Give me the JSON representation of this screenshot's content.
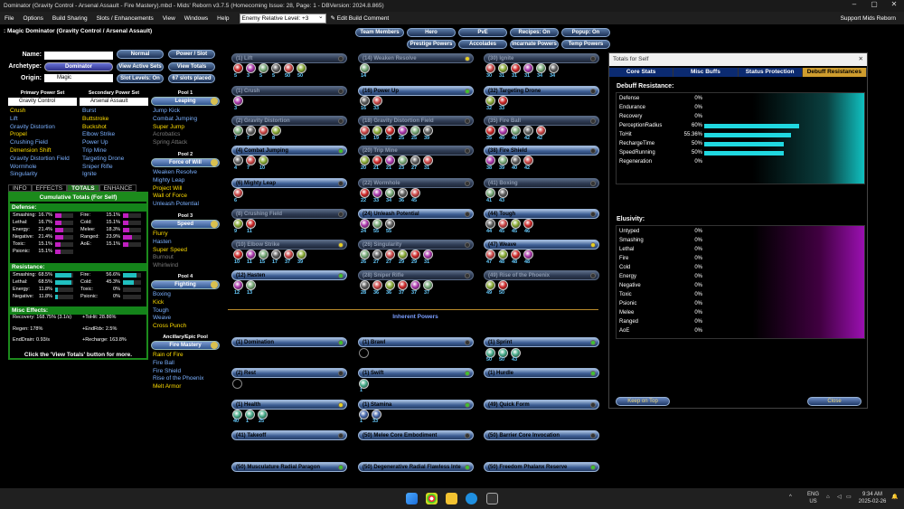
{
  "window": {
    "title": "Dominator (Gravity Control - Arsenal Assault - Fire Mastery).mbd - Mids' Reborn v3.7.5  (Homecoming Issue: 28, Page: 1 - DBVersion: 2024.8.865)"
  },
  "menu": {
    "items": [
      "File",
      "Options",
      "Build Sharing",
      "Slots / Enhancements",
      "View",
      "Windows",
      "Help"
    ],
    "level": "Enemy Relative Level: +3",
    "edit_comment": "Edit Build Comment",
    "support": "Support Mids Reborn"
  },
  "build": {
    "heading": ": Magic Dominator (Gravity Control / Arsenal Assault)"
  },
  "top_buttons": [
    "Team Members",
    "Hero",
    "PvE",
    "Recipes: On",
    "Popup: On",
    "Prestige Powers",
    "Accolades",
    "Incarnate Powers",
    "Temp Powers"
  ],
  "char": {
    "name_label": "Name:",
    "name_value": "",
    "archetype_label": "Archetype:",
    "archetype_value": "Dominator",
    "origin_label": "Origin:",
    "origin_value": "Magic"
  },
  "side_buttons": {
    "normal": "Normal",
    "power_slot": "Power / Slot",
    "view_active_sets": "View Active Sets",
    "view_totals": "View Totals",
    "slot_levels": "Slot Levels: On",
    "slots_placed": "67 slots placed"
  },
  "primary": {
    "header": "Primary Power Set",
    "selected": "Gravity Control",
    "powers": [
      "Crush",
      "Lift",
      "Gravity Distortion",
      "Propel",
      "Crushing Field",
      "Dimension Shift",
      "Gravity Distortion Field",
      "Wormhole",
      "Singularity"
    ]
  },
  "secondary": {
    "header": "Secondary Power Set",
    "selected": "Arsenal Assault",
    "powers": [
      "Burst",
      "Buttstroke",
      "Buckshot",
      "Elbow Strike",
      "Power Up",
      "Trip Mine",
      "Targeting Drone",
      "Sniper Rifle",
      "Ignite"
    ]
  },
  "pools": [
    {
      "header": "Pool 1",
      "name": "Leaping",
      "powers": [
        "Jump Kick",
        "Combat Jumping",
        "Super Jump",
        "Acrobatics",
        "Spring Attack"
      ]
    },
    {
      "header": "Pool 2",
      "name": "Force of Will",
      "powers": [
        "Weaken Resolve",
        "Mighty Leap",
        "Project Will",
        "Wall of Force",
        "Unleash Potential"
      ]
    },
    {
      "header": "Pool 3",
      "name": "Speed",
      "powers": [
        "Flurry",
        "Hasten",
        "Super Speed",
        "Burnout",
        "Whirlwind"
      ]
    },
    {
      "header": "Pool 4",
      "name": "Fighting",
      "powers": [
        "Boxing",
        "Kick",
        "Tough",
        "Weave",
        "Cross Punch"
      ]
    },
    {
      "header": "Ancillary/Epic Pool",
      "name": "Fire Mastery",
      "powers": [
        "Rain of Fire",
        "Fire Ball",
        "Fire Shield",
        "Rise of the Phoenix",
        "Melt Armor"
      ]
    }
  ],
  "info_tabs": [
    "INFO",
    "EFFECTS",
    "TOTALS",
    "ENHANCE"
  ],
  "totals": {
    "title": "Cumulative Totals (For Self)",
    "defense_label": "Defense:",
    "defense": [
      [
        "Smashing:",
        "16.7%",
        0.33
      ],
      [
        "Lethal:",
        "16.7%",
        0.33
      ],
      [
        "Energy:",
        "21.4%",
        0.43
      ],
      [
        "Negative:",
        "21.4%",
        0.43
      ],
      [
        "Toxic:",
        "15.1%",
        0.3
      ],
      [
        "Psionic:",
        "15.1%",
        0.3
      ]
    ],
    "defense2": [
      [
        "Fire:",
        "15.1%",
        0.3
      ],
      [
        "Cold:",
        "15.1%",
        0.3
      ],
      [
        "Melee:",
        "18.3%",
        0.37
      ],
      [
        "Ranged:",
        "23.9%",
        0.48
      ],
      [
        "AoE:",
        "15.1%",
        0.3
      ]
    ],
    "resistance_label": "Resistance:",
    "resistance": [
      [
        "Smashing:",
        "68.5%",
        0.9
      ],
      [
        "Lethal:",
        "68.5%",
        0.9
      ],
      [
        "Energy:",
        "11.8%",
        0.15
      ],
      [
        "Negative:",
        "11.8%",
        0.15
      ]
    ],
    "resistance2": [
      [
        "Fire:",
        "56.6%",
        0.75
      ],
      [
        "Cold:",
        "45.3%",
        0.6
      ],
      [
        "Toxic:",
        "0%",
        0.0
      ],
      [
        "Psionic:",
        "0%",
        0.0
      ]
    ],
    "misc_label": "Misc Effects:",
    "misc": [
      "Recovery: 168.75% (3.1/s)",
      "+ToHit: 28.86%",
      "Regen: 178%",
      "+EndRdx: 2.5%",
      "EndDrain: 0.93/s",
      "+Recharge: 163.8%"
    ],
    "footnote": "Click the 'View Totals' button for more."
  },
  "slots": [
    {
      "label": "(1) Lift",
      "enh": [
        "5",
        "3",
        "5",
        "5",
        "50",
        "50"
      ],
      "dot": "",
      "dim": true
    },
    {
      "label": "(1) Crush",
      "enh": [
        "3"
      ],
      "dot": "",
      "dim": true
    },
    {
      "label": "(2) Gravity Distortion",
      "enh": [
        "7",
        "7",
        "8",
        "8"
      ],
      "dot": "",
      "dim": true
    },
    {
      "label": "(4) Combat Jumping",
      "enh": [
        "4",
        "7",
        "10"
      ],
      "dot": "g",
      "dim": false
    },
    {
      "label": "(6) Mighty Leap",
      "enh": [
        "6"
      ],
      "dot": "",
      "dim": false
    },
    {
      "label": "(8) Crushing Field",
      "enh": [
        "9",
        "11"
      ],
      "dot": "",
      "dim": true
    },
    {
      "label": "(10) Elbow Strike",
      "enh": [
        "10",
        "11",
        "15",
        "17",
        "37",
        "39"
      ],
      "dot": "y",
      "dim": true
    },
    {
      "label": "(12) Hasten",
      "enh": [
        "12",
        "13"
      ],
      "dot": "g",
      "dim": false
    },
    {
      "label": "(14) Weaken Resolve",
      "enh": [
        "14"
      ],
      "dot": "y",
      "dim": true
    },
    {
      "label": "(16) Power Up",
      "enh": [
        "16",
        "33"
      ],
      "dot": "g",
      "dim": false
    },
    {
      "label": "(18) Gravity Distortion Field",
      "enh": [
        "18",
        "19",
        "23",
        "25",
        "25",
        "39"
      ],
      "dot": "",
      "dim": true
    },
    {
      "label": "(20) Trip Mine",
      "enh": [
        "20",
        "21",
        "21",
        "23",
        "27",
        "31"
      ],
      "dot": "",
      "dim": true
    },
    {
      "label": "(22) Wormhole",
      "enh": [
        "22",
        "33",
        "34",
        "36",
        "45"
      ],
      "dot": "",
      "dim": true
    },
    {
      "label": "(24) Unleash Potential",
      "enh": [
        "24",
        "55",
        "55"
      ],
      "dot": "",
      "dim": false
    },
    {
      "label": "(26) Singularity",
      "enh": [
        "26",
        "27",
        "27",
        "29",
        "29",
        "31"
      ],
      "dot": "",
      "dim": true
    },
    {
      "label": "(28) Sniper Rifle",
      "enh": [
        "28",
        "36",
        "36",
        "37",
        "37",
        "37"
      ],
      "dot": "",
      "dim": true
    },
    {
      "label": "(30) Ignite",
      "enh": [
        "30",
        "31",
        "31",
        "31",
        "34",
        "34"
      ],
      "dot": "",
      "dim": true
    },
    {
      "label": "(32) Targeting Drone",
      "enh": [
        "32",
        "33"
      ],
      "dot": "",
      "dim": false
    },
    {
      "label": "(35) Fire Ball",
      "enh": [
        "35",
        "40",
        "40",
        "42",
        "42"
      ],
      "dot": "",
      "dim": true
    },
    {
      "label": "(38) Fire Shield",
      "enh": [
        "38",
        "39",
        "40",
        "42"
      ],
      "dot": "",
      "dim": false
    },
    {
      "label": "(41) Boxing",
      "enh": [
        "41",
        "43"
      ],
      "dot": "",
      "dim": true
    },
    {
      "label": "(44) Tough",
      "enh": [
        "44",
        "45",
        "45",
        "46"
      ],
      "dot": "",
      "dim": false
    },
    {
      "label": "(47) Weave",
      "enh": [
        "47",
        "48",
        "48",
        "48"
      ],
      "dot": "y",
      "dim": false
    },
    {
      "label": "(49) Rise of the Phoenix",
      "enh": [
        "49",
        "50"
      ],
      "dot": "",
      "dim": true
    }
  ],
  "inherent": {
    "header": "Inherent Powers",
    "powers": [
      {
        "label": "(1) Domination",
        "dot": "g"
      },
      {
        "label": "(1) Brawl",
        "dot": ""
      },
      {
        "label": "(1) Sprint",
        "dot": "g"
      },
      {
        "label": "(2) Rest",
        "dot": ""
      },
      {
        "label": "(1) Swift",
        "dot": "g"
      },
      {
        "label": "(1) Hurdle",
        "dot": "g"
      },
      {
        "label": "(1) Health",
        "dot": "y"
      },
      {
        "label": "(1) Stamina",
        "dot": "g"
      },
      {
        "label": "(49) Quick Form",
        "dot": ""
      },
      {
        "label": "(41) Takeoff",
        "dot": ""
      },
      {
        "label": "(50) Melee Core Embodiment",
        "dot": ""
      },
      {
        "label": "(50) Barrier Core Invocation",
        "dot": ""
      },
      {
        "label": "(50) Musculature Radial Paragon",
        "dot": "g"
      },
      {
        "label": "(50) Degenerative Radial Flawless Inte",
        "dot": "g"
      },
      {
        "label": "(50) Freedom Phalanx Reserve",
        "dot": "g"
      }
    ]
  },
  "inherent_enh": {
    "sprint": [
      "50",
      "50",
      "43"
    ],
    "swift": [
      "1"
    ],
    "health": [
      "40",
      "1",
      "25"
    ],
    "stamina": [
      "1",
      "33"
    ]
  },
  "right_panel": {
    "title": "Totals for Self",
    "tabs": [
      "Core Stats",
      "Misc Buffs",
      "Status Protection",
      "Debuff Resistances"
    ],
    "debuff_label": "Debuff Resistance:",
    "debuff": [
      [
        "Defense",
        "0%",
        0
      ],
      [
        "Endurance",
        "0%",
        0
      ],
      [
        "Recovery",
        "0%",
        0
      ],
      [
        "PerceptionRadius",
        "60%",
        0.6
      ],
      [
        "ToHit",
        "55.36%",
        0.55
      ],
      [
        "RechargeTime",
        "50%",
        0.5
      ],
      [
        "SpeedRunning",
        "50%",
        0.5
      ],
      [
        "Regeneration",
        "0%",
        0
      ]
    ],
    "elusivity_label": "Elusivity:",
    "elusivity": [
      [
        "Untyped",
        "0%"
      ],
      [
        "Smashing",
        "0%"
      ],
      [
        "Lethal",
        "0%"
      ],
      [
        "Fire",
        "0%"
      ],
      [
        "Cold",
        "0%"
      ],
      [
        "Energy",
        "0%"
      ],
      [
        "Negative",
        "0%"
      ],
      [
        "Toxic",
        "0%"
      ],
      [
        "Psionic",
        "0%"
      ],
      [
        "Melee",
        "0%"
      ],
      [
        "Ranged",
        "0%"
      ],
      [
        "AoE",
        "0%"
      ]
    ],
    "keep_on_top": "Keep on Top",
    "close": "Close"
  },
  "taskbar": {
    "lang1": "ENG",
    "lang2": "US",
    "time": "9:34 AM",
    "date": "2025-02-26"
  },
  "colors": {
    "accent": "#cf9d2e",
    "defense_bar": "#c020c0",
    "resist_bar": "#20c0c0",
    "panel_green": "#14841a"
  }
}
